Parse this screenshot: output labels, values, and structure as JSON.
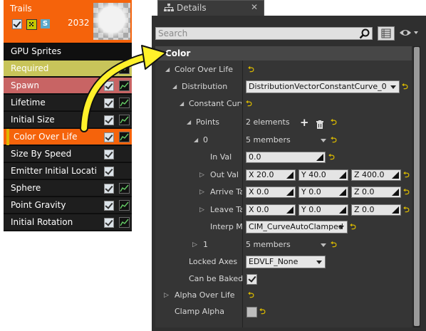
{
  "emitter": {
    "name": "Trails",
    "count": "2032",
    "solo_letter": "S",
    "modules": [
      {
        "label": "GPU Sprites",
        "bg": "#101010",
        "checkbox": false,
        "graph": false
      },
      {
        "label": "Required",
        "bg": "#c8c45a",
        "checkbox": false,
        "graph": true
      },
      {
        "label": "Spawn",
        "bg": "#c86464",
        "checkbox": true,
        "graph": true
      },
      {
        "label": "Lifetime",
        "bg": "#1e1e1e",
        "checkbox": true,
        "graph": true
      },
      {
        "label": "Initial Size",
        "bg": "#1e1e1e",
        "checkbox": true,
        "graph": true
      },
      {
        "label": "Color Over Life",
        "bg": "#f5630b",
        "checkbox": true,
        "graph": true,
        "selected": true
      },
      {
        "label": "Size By Speed",
        "bg": "#1e1e1e",
        "checkbox": true,
        "graph": false
      },
      {
        "label": "Emitter Initial Locati",
        "bg": "#1e1e1e",
        "checkbox": true,
        "graph": false
      },
      {
        "label": "Sphere",
        "bg": "#1e1e1e",
        "checkbox": true,
        "graph": true
      },
      {
        "label": "Point Gravity",
        "bg": "#1e1e1e",
        "checkbox": true,
        "graph": true
      },
      {
        "label": "Initial Rotation",
        "bg": "#1e1e1e",
        "checkbox": true,
        "graph": true
      }
    ]
  },
  "details": {
    "tab_title": "Details",
    "search_placeholder": "Search",
    "category": "Color",
    "rows": {
      "color_over_life": "Color Over Life",
      "distribution": "Distribution",
      "distribution_value": "DistributionVectorConstantCurve_0",
      "constant_curve": "Constant Curve",
      "points": "Points",
      "points_value": "2 elements",
      "point0": "0",
      "point0_value": "5 members",
      "in_val": "In Val",
      "in_val_value": "0.0",
      "out_val": "Out Val",
      "out_x": "X  20.0",
      "out_y": "Y  40.0",
      "out_z": "Z  400.0",
      "arrive": "Arrive Ta",
      "arrive_x": "X  0.0",
      "arrive_y": "Y  0.0",
      "arrive_z": "Z  0.0",
      "leave": "Leave Ta",
      "leave_x": "X  0.0",
      "leave_y": "Y  0.0",
      "leave_z": "Z  0.0",
      "interp": "Interp Mo",
      "interp_value": "CIM_CurveAutoClamped",
      "point1": "1",
      "point1_value": "5 members",
      "locked_axes": "Locked Axes",
      "locked_axes_value": "EDVLF_None",
      "can_be_baked": "Can be Baked",
      "alpha_over_life": "Alpha Over Life",
      "clamp_alpha": "Clamp Alpha"
    }
  },
  "colors": {
    "accent_orange": "#f5630b",
    "callout_yellow": "#fff12a",
    "reset_arrow": "#d8b800"
  }
}
